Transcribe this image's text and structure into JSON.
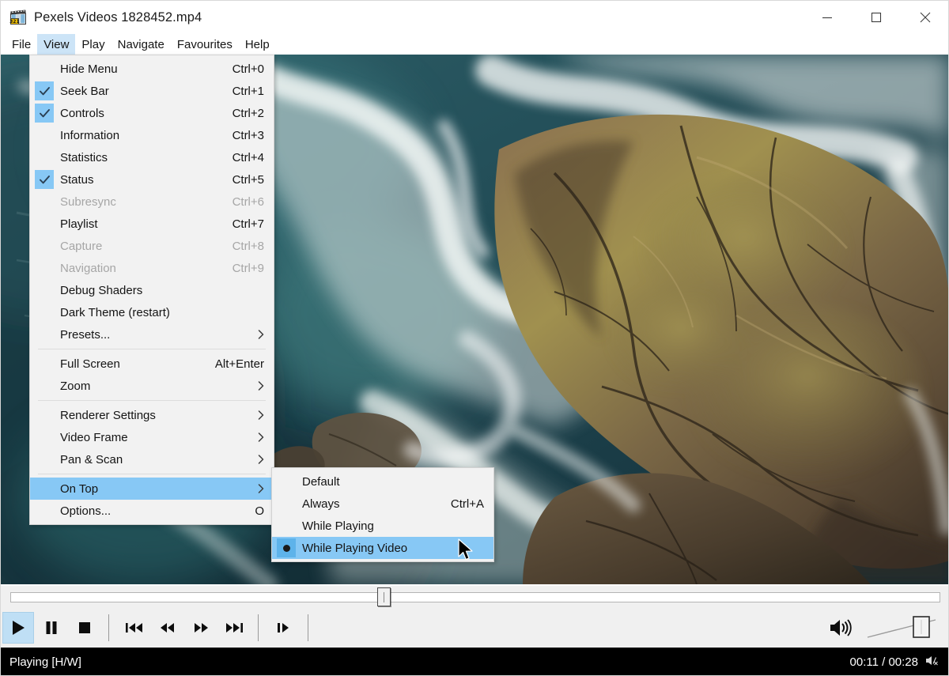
{
  "window": {
    "title": "Pexels Videos 1828452.mp4",
    "icon": "mpc-clapperboard-icon",
    "icon_digits": "321",
    "controls": {
      "minimize": "Minimize",
      "maximize": "Maximize",
      "close": "Close"
    }
  },
  "menubar": {
    "items": [
      {
        "label": "File",
        "active": false
      },
      {
        "label": "View",
        "active": true
      },
      {
        "label": "Play",
        "active": false
      },
      {
        "label": "Navigate",
        "active": false
      },
      {
        "label": "Favourites",
        "active": false
      },
      {
        "label": "Help",
        "active": false
      }
    ]
  },
  "view_menu": {
    "items": [
      {
        "label": "Hide Menu",
        "accel": "Ctrl+0",
        "checked": false,
        "disabled": false,
        "submenu": false,
        "highlighted": false
      },
      {
        "label": "Seek Bar",
        "accel": "Ctrl+1",
        "checked": true,
        "disabled": false,
        "submenu": false,
        "highlighted": false
      },
      {
        "label": "Controls",
        "accel": "Ctrl+2",
        "checked": true,
        "disabled": false,
        "submenu": false,
        "highlighted": false
      },
      {
        "label": "Information",
        "accel": "Ctrl+3",
        "checked": false,
        "disabled": false,
        "submenu": false,
        "highlighted": false
      },
      {
        "label": "Statistics",
        "accel": "Ctrl+4",
        "checked": false,
        "disabled": false,
        "submenu": false,
        "highlighted": false
      },
      {
        "label": "Status",
        "accel": "Ctrl+5",
        "checked": true,
        "disabled": false,
        "submenu": false,
        "highlighted": false
      },
      {
        "label": "Subresync",
        "accel": "Ctrl+6",
        "checked": false,
        "disabled": true,
        "submenu": false,
        "highlighted": false
      },
      {
        "label": "Playlist",
        "accel": "Ctrl+7",
        "checked": false,
        "disabled": false,
        "submenu": false,
        "highlighted": false
      },
      {
        "label": "Capture",
        "accel": "Ctrl+8",
        "checked": false,
        "disabled": true,
        "submenu": false,
        "highlighted": false
      },
      {
        "label": "Navigation",
        "accel": "Ctrl+9",
        "checked": false,
        "disabled": true,
        "submenu": false,
        "highlighted": false
      },
      {
        "label": "Debug Shaders",
        "accel": "",
        "checked": false,
        "disabled": false,
        "submenu": false,
        "highlighted": false
      },
      {
        "label": "Dark Theme (restart)",
        "accel": "",
        "checked": false,
        "disabled": false,
        "submenu": false,
        "highlighted": false
      },
      {
        "label": "Presets...",
        "accel": "",
        "checked": false,
        "disabled": false,
        "submenu": true,
        "highlighted": false
      },
      {
        "separator": true
      },
      {
        "label": "Full Screen",
        "accel": "Alt+Enter",
        "checked": false,
        "disabled": false,
        "submenu": false,
        "highlighted": false
      },
      {
        "label": "Zoom",
        "accel": "",
        "checked": false,
        "disabled": false,
        "submenu": true,
        "highlighted": false
      },
      {
        "separator": true
      },
      {
        "label": "Renderer Settings",
        "accel": "",
        "checked": false,
        "disabled": false,
        "submenu": true,
        "highlighted": false
      },
      {
        "label": "Video Frame",
        "accel": "",
        "checked": false,
        "disabled": false,
        "submenu": true,
        "highlighted": false
      },
      {
        "label": "Pan & Scan",
        "accel": "",
        "checked": false,
        "disabled": false,
        "submenu": true,
        "highlighted": false
      },
      {
        "separator": true
      },
      {
        "label": "On Top",
        "accel": "",
        "checked": false,
        "disabled": false,
        "submenu": true,
        "highlighted": true
      },
      {
        "label": "Options...",
        "accel": "O",
        "checked": false,
        "disabled": false,
        "submenu": false,
        "highlighted": false
      }
    ]
  },
  "ontop_submenu": {
    "items": [
      {
        "label": "Default",
        "accel": "",
        "selected": false,
        "highlighted": false
      },
      {
        "label": "Always",
        "accel": "Ctrl+A",
        "selected": false,
        "highlighted": false
      },
      {
        "label": "While Playing",
        "accel": "",
        "selected": false,
        "highlighted": false
      },
      {
        "label": "While Playing Video",
        "accel": "",
        "selected": true,
        "highlighted": true
      }
    ]
  },
  "video": {
    "description": "Aerial drone view of rocky coastline with teal ocean and white surf",
    "ocean_color": "#24505a",
    "deep_ocean_color": "#152f38",
    "rock_color": "#6e5a42",
    "rock_highlight": "#9c8a55",
    "foam_color": "#f2f4f3"
  },
  "seekbar": {
    "name": "seek-bar",
    "position_percent": 40,
    "thumb_label": ""
  },
  "controls": {
    "buttons": [
      {
        "name": "play-button",
        "label": "Play",
        "icon": "play-icon",
        "active": true
      },
      {
        "name": "pause-button",
        "label": "Pause",
        "icon": "pause-icon",
        "active": false
      },
      {
        "name": "stop-button",
        "label": "Stop",
        "icon": "stop-icon",
        "active": false
      },
      {
        "name": "skip-back-button",
        "label": "Skip Back",
        "icon": "skip-back-icon",
        "active": false
      },
      {
        "name": "rewind-button",
        "label": "Decrease Rate",
        "icon": "rewind-icon",
        "active": false
      },
      {
        "name": "fastforward-button",
        "label": "Increase Rate",
        "icon": "fast-forward-icon",
        "active": false
      },
      {
        "name": "skip-forward-button",
        "label": "Skip Forward",
        "icon": "skip-forward-icon",
        "active": false
      },
      {
        "name": "frame-step-button",
        "label": "Step Frame",
        "icon": "frame-step-icon",
        "active": false
      }
    ],
    "volume": {
      "name": "volume-slider",
      "icon": "speaker-icon",
      "level_percent": 100
    }
  },
  "statusbar": {
    "status_text": "Playing [H/W]",
    "time_current": "00:11",
    "time_separator": "/",
    "time_total": "00:28",
    "time_display": "00:11 / 00:28",
    "mute_icon": "speaker-muted-icon"
  }
}
